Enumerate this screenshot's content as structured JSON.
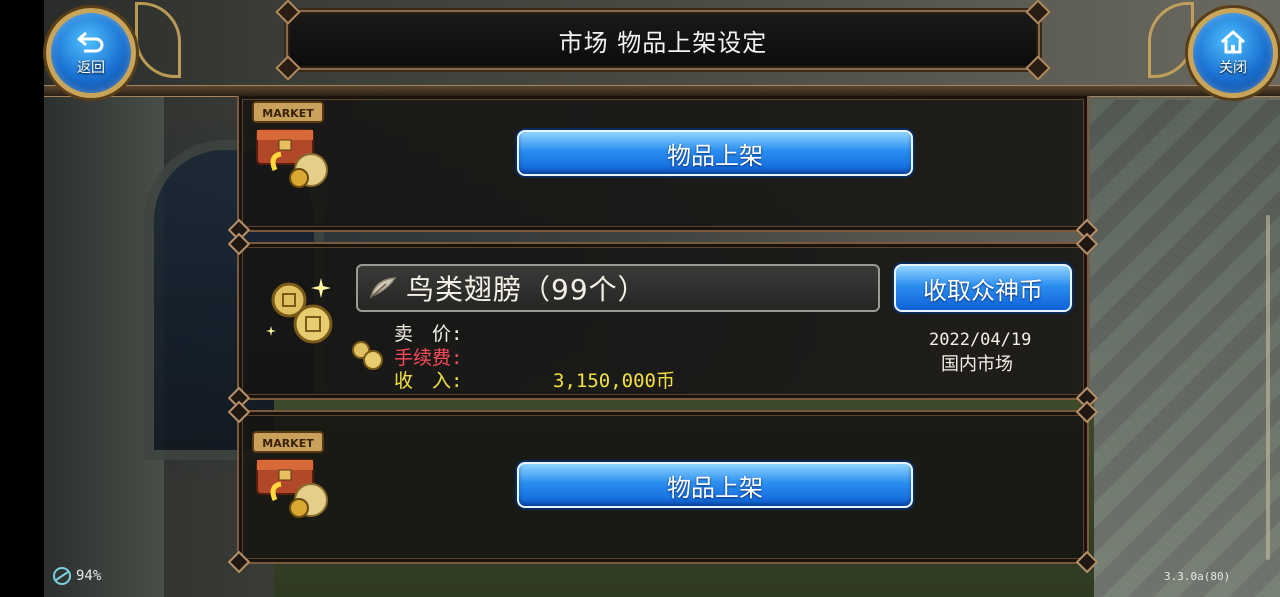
{
  "header": {
    "title": "市场  物品上架设定",
    "back_label": "返回",
    "close_label": "关闭"
  },
  "slots": [
    {
      "button_label": "物品上架",
      "market_icon_text": "MARKET"
    },
    {
      "item_name": "鸟类翅膀（99个）",
      "collect_label": "收取众神币",
      "price_label": "卖　价:",
      "fee_label": "手续费:",
      "income_label": "收　入:",
      "income_value": "3,150,000币",
      "date": "2022/04/19",
      "market": "国内市场"
    },
    {
      "button_label": "物品上架",
      "market_icon_text": "MARKET"
    }
  ],
  "footer": {
    "battery": "94%",
    "version": "3.3.0a(80)"
  },
  "colors": {
    "button_blue": "#2b8ef0",
    "panel_border": "#7a5a3c",
    "fee_red": "#ff4a5a",
    "income_yellow": "#f2e040",
    "gold_ring": "#c9a55a"
  },
  "icons": [
    "back-arrow-icon",
    "home-icon",
    "market-chest-icon",
    "coins-icon",
    "feather-icon",
    "battery-icon"
  ]
}
